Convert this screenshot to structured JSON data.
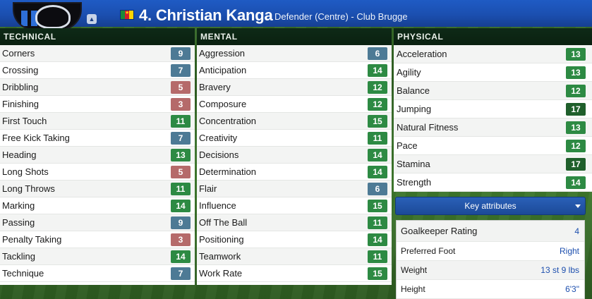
{
  "header": {
    "player_name": "4. Christian Kanga",
    "player_role": "Defender (Centre) - Club Brugge",
    "flag_icon": "cameroon-flag-icon",
    "club_icon": "club-brugge-badge-icon"
  },
  "technical": {
    "title": "TECHNICAL",
    "items": [
      {
        "label": "Corners",
        "value": "9",
        "tier": "mid"
      },
      {
        "label": "Crossing",
        "value": "7",
        "tier": "mid"
      },
      {
        "label": "Dribbling",
        "value": "5",
        "tier": "low"
      },
      {
        "label": "Finishing",
        "value": "3",
        "tier": "low"
      },
      {
        "label": "First Touch",
        "value": "11",
        "tier": "good"
      },
      {
        "label": "Free Kick Taking",
        "value": "7",
        "tier": "mid"
      },
      {
        "label": "Heading",
        "value": "13",
        "tier": "good"
      },
      {
        "label": "Long Shots",
        "value": "5",
        "tier": "low"
      },
      {
        "label": "Long Throws",
        "value": "11",
        "tier": "good"
      },
      {
        "label": "Marking",
        "value": "14",
        "tier": "good"
      },
      {
        "label": "Passing",
        "value": "9",
        "tier": "mid"
      },
      {
        "label": "Penalty Taking",
        "value": "3",
        "tier": "low"
      },
      {
        "label": "Tackling",
        "value": "14",
        "tier": "good"
      },
      {
        "label": "Technique",
        "value": "7",
        "tier": "mid"
      }
    ]
  },
  "mental": {
    "title": "MENTAL",
    "items": [
      {
        "label": "Aggression",
        "value": "6",
        "tier": "mid"
      },
      {
        "label": "Anticipation",
        "value": "14",
        "tier": "good"
      },
      {
        "label": "Bravery",
        "value": "12",
        "tier": "good"
      },
      {
        "label": "Composure",
        "value": "12",
        "tier": "good"
      },
      {
        "label": "Concentration",
        "value": "15",
        "tier": "good"
      },
      {
        "label": "Creativity",
        "value": "11",
        "tier": "good"
      },
      {
        "label": "Decisions",
        "value": "14",
        "tier": "good"
      },
      {
        "label": "Determination",
        "value": "14",
        "tier": "good"
      },
      {
        "label": "Flair",
        "value": "6",
        "tier": "mid"
      },
      {
        "label": "Influence",
        "value": "15",
        "tier": "good"
      },
      {
        "label": "Off The Ball",
        "value": "11",
        "tier": "good"
      },
      {
        "label": "Positioning",
        "value": "14",
        "tier": "good"
      },
      {
        "label": "Teamwork",
        "value": "11",
        "tier": "good"
      },
      {
        "label": "Work Rate",
        "value": "15",
        "tier": "good"
      }
    ]
  },
  "physical": {
    "title": "PHYSICAL",
    "items": [
      {
        "label": "Acceleration",
        "value": "13",
        "tier": "good"
      },
      {
        "label": "Agility",
        "value": "13",
        "tier": "good"
      },
      {
        "label": "Balance",
        "value": "12",
        "tier": "good"
      },
      {
        "label": "Jumping",
        "value": "17",
        "tier": "high"
      },
      {
        "label": "Natural Fitness",
        "value": "13",
        "tier": "good"
      },
      {
        "label": "Pace",
        "value": "12",
        "tier": "good"
      },
      {
        "label": "Stamina",
        "value": "17",
        "tier": "high"
      },
      {
        "label": "Strength",
        "value": "14",
        "tier": "good"
      }
    ]
  },
  "key_attributes": {
    "button_label": "Key attributes",
    "rows": [
      {
        "label": "Goalkeeper Rating",
        "value": "4"
      },
      {
        "label": "Preferred Foot",
        "value": "Right"
      },
      {
        "label": "Weight",
        "value": "13 st 9 lbs"
      },
      {
        "label": "Height",
        "value": "6'3\""
      }
    ]
  },
  "colors": {
    "header_blue": "#1b4fb0",
    "panel_head": "#0e2a17",
    "tier_low": "#b56a6a",
    "tier_mid": "#4d7a95",
    "tier_good": "#2d8a43",
    "tier_high": "#1f5f2b",
    "link_blue": "#1d4fae"
  }
}
